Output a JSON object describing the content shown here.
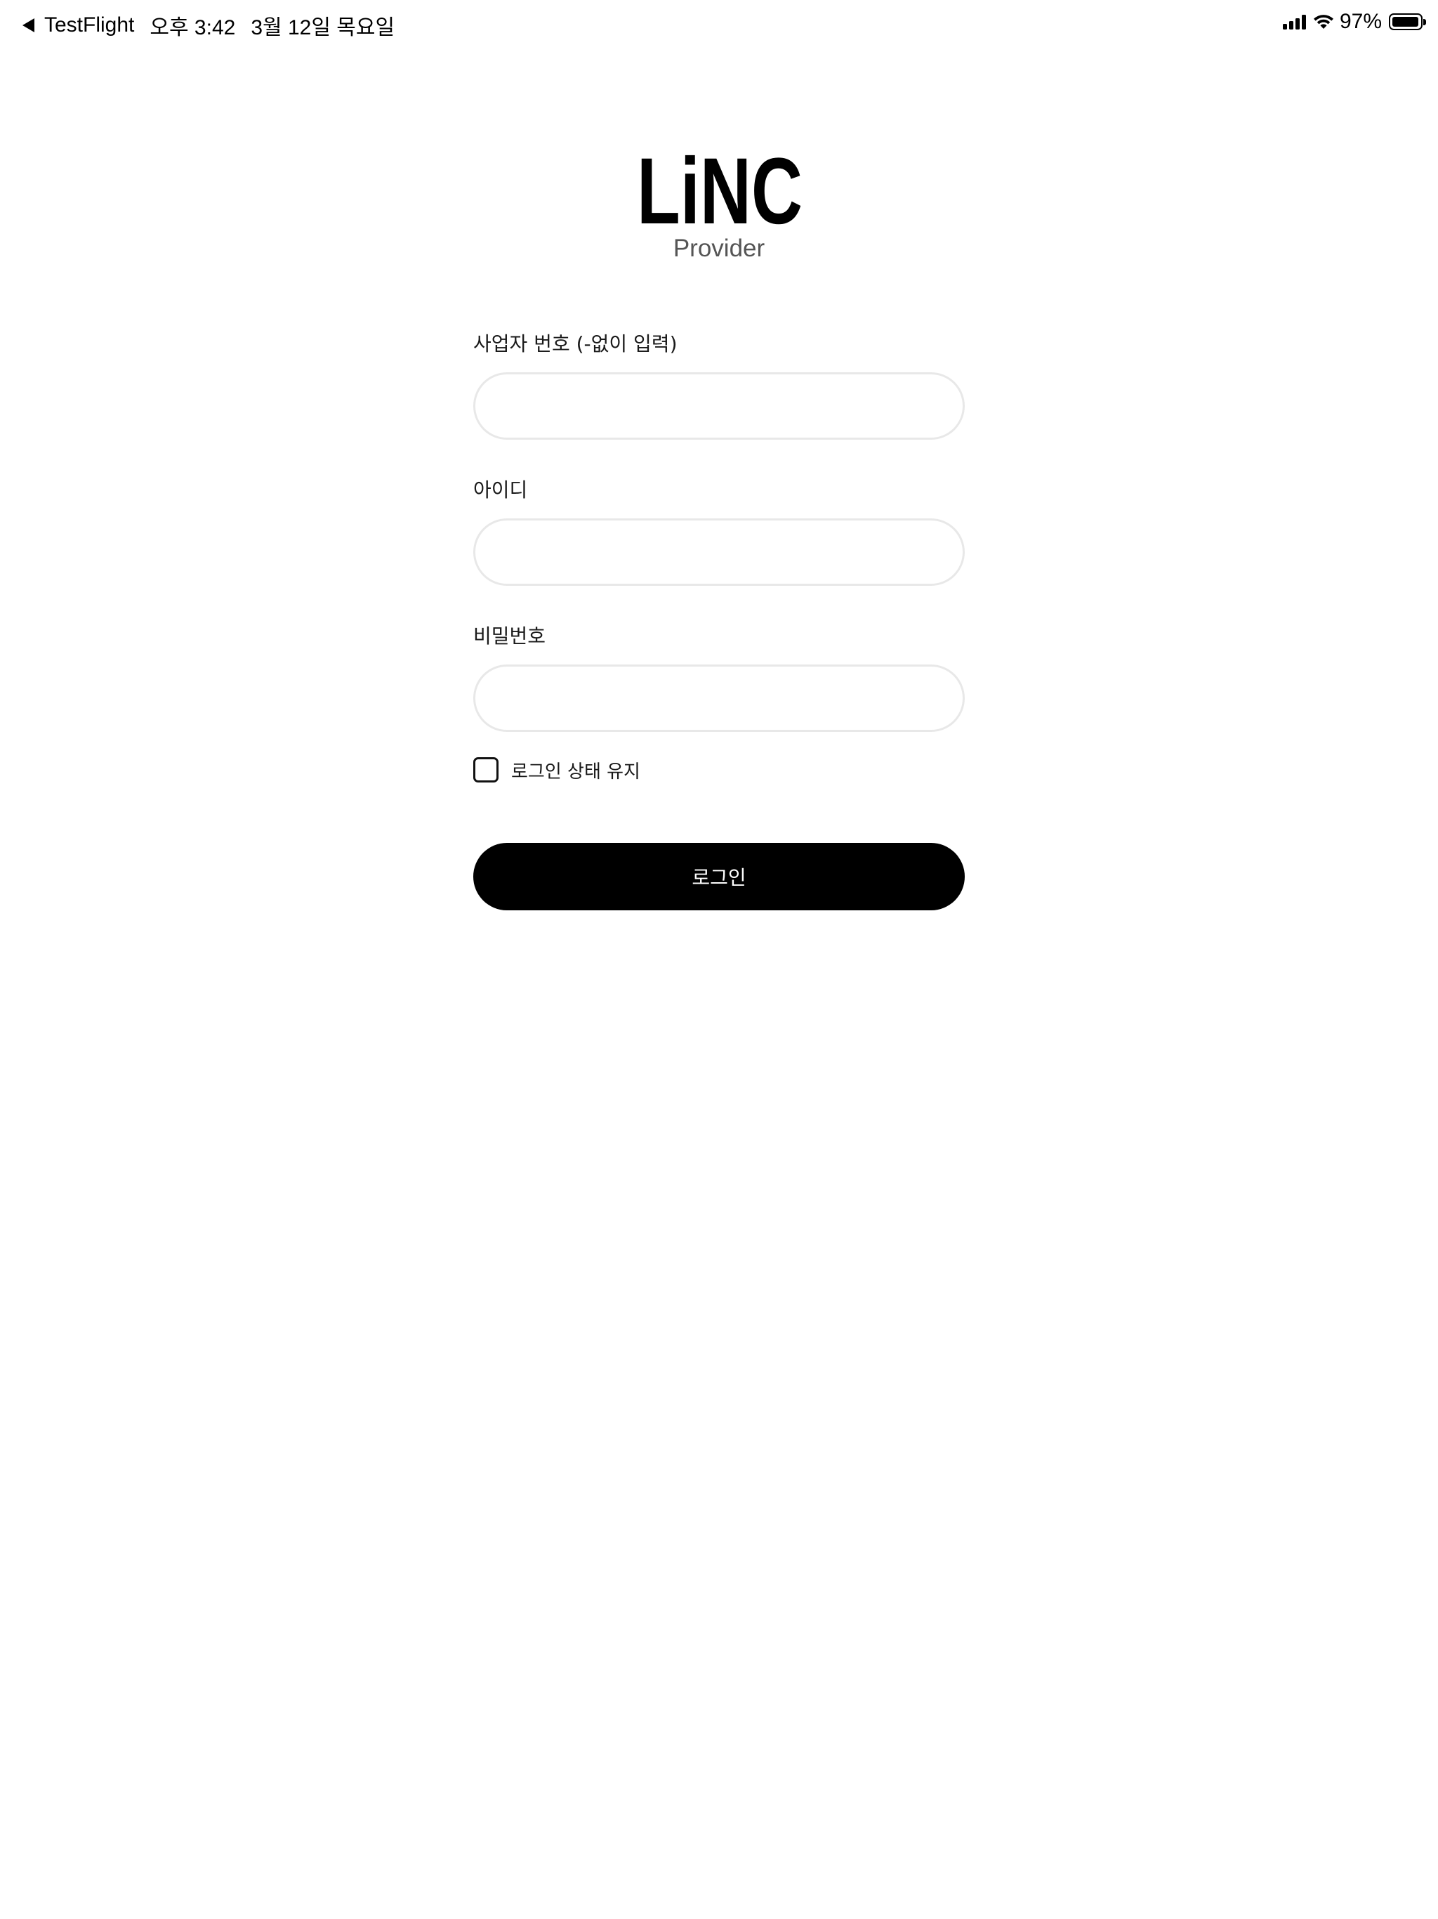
{
  "status_bar": {
    "back_app": "TestFlight",
    "time": "오후 3:42",
    "date": "3월 12일 목요일",
    "battery_percent": "97%",
    "battery_level": 0.97,
    "icons": [
      "back-arrow-icon",
      "signal-icon",
      "wifi-icon",
      "battery-icon"
    ]
  },
  "brand": {
    "logo_text": "LiNC",
    "subtitle": "Provider"
  },
  "form": {
    "business_number": {
      "label": "사업자 번호 (-없이 입력)",
      "value": "",
      "placeholder": ""
    },
    "user_id": {
      "label": "아이디",
      "value": "",
      "placeholder": ""
    },
    "password": {
      "label": "비밀번호",
      "value": "",
      "placeholder": ""
    },
    "keep_logged_in": {
      "label": "로그인 상태 유지",
      "checked": false
    },
    "login_button": "로그인"
  },
  "colors": {
    "button": "#000000",
    "input_border": "#e8e8e8",
    "subtitle": "#555555"
  }
}
